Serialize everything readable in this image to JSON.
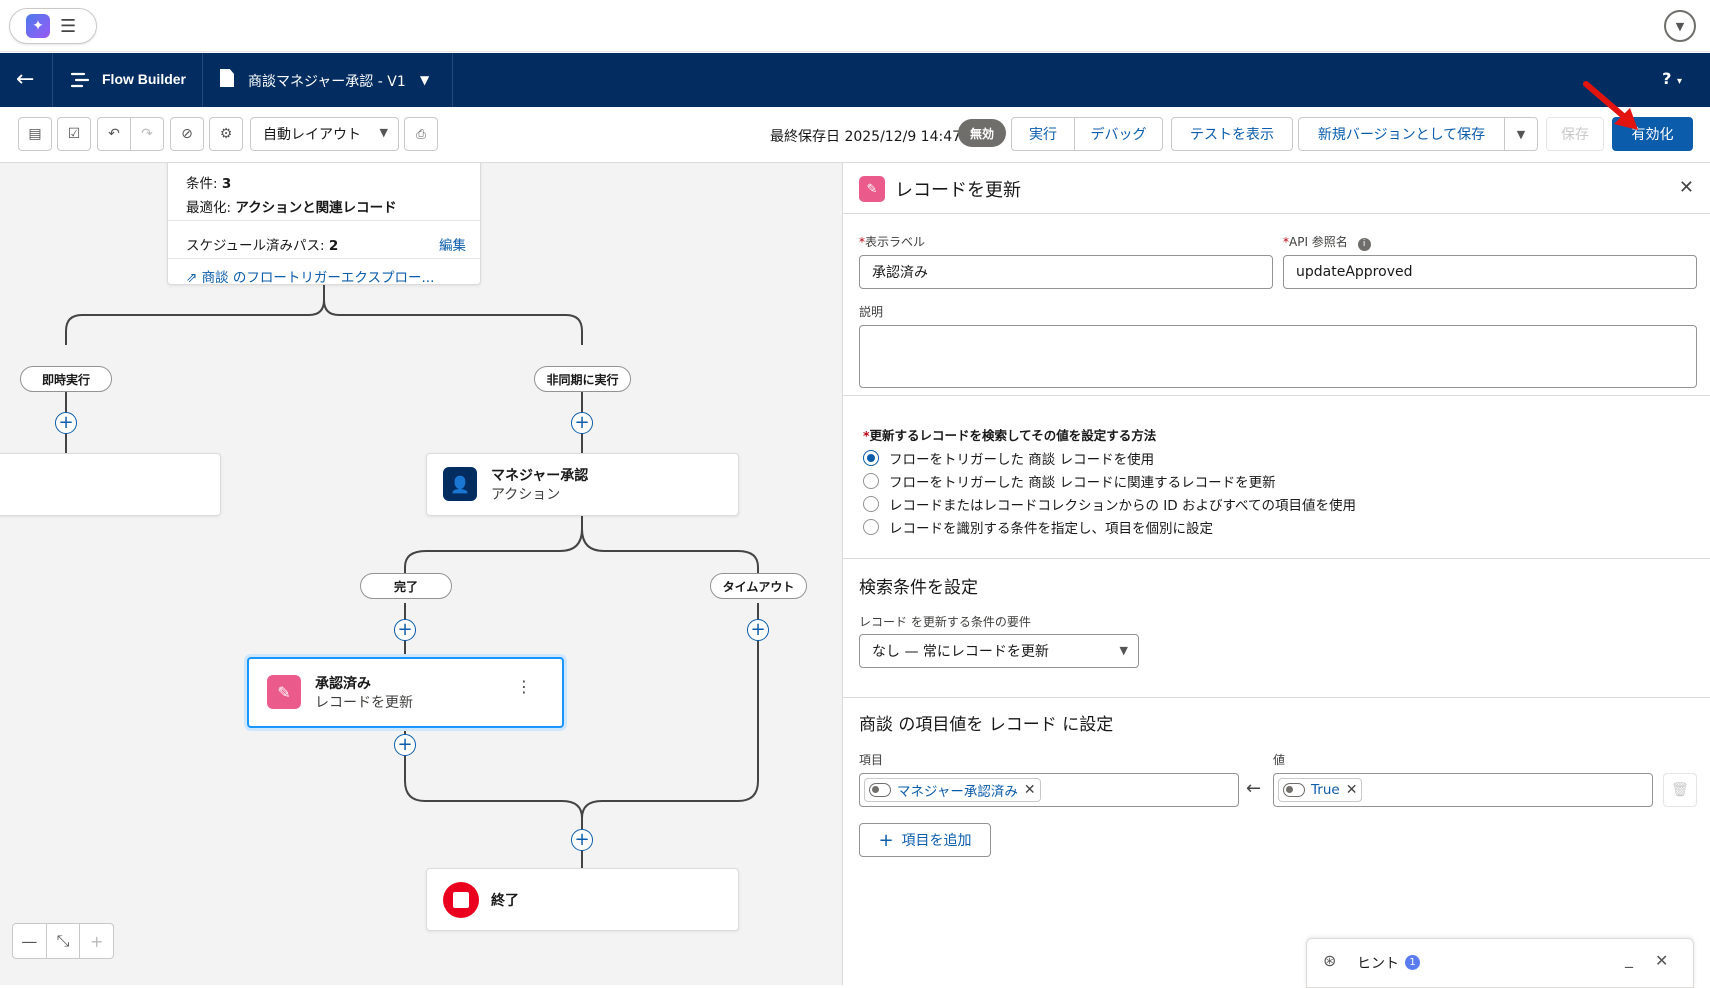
{
  "app": {
    "name": "Flow Builder",
    "flow_title": "商談マネジャー承認 - V1",
    "help_label": "?"
  },
  "toolbar": {
    "layout_mode": "自動レイアウト",
    "last_saved": "最終保存日 2025/12/9 14:47",
    "status_badge": "無効",
    "run": "実行",
    "debug": "デバッグ",
    "view_tests": "テストを表示",
    "save_as_new_version": "新規バージョンとして保存",
    "save": "保存",
    "activate": "有効化"
  },
  "canvas": {
    "start_card": {
      "conditions_label": "条件: ",
      "conditions_value": "3",
      "optimize_label": "最適化: ",
      "optimize_value": "アクションと関連レコード",
      "scheduled_label": "スケジュール済みパス: ",
      "scheduled_value": "2",
      "edit": "編集",
      "explorer_link": "商談 のフロートリガーエクスプロー..."
    },
    "paths": {
      "immediate": "即時実行",
      "async": "非同期に実行",
      "complete": "完了",
      "timeout": "タイムアウト"
    },
    "action_node": {
      "title": "マネジャー承認",
      "subtitle": "アクション"
    },
    "update_node": {
      "title": "承認済み",
      "subtitle": "レコードを更新"
    },
    "end_node": {
      "title": "終了"
    },
    "zoom": {
      "out": "—",
      "fit": "⤡",
      "in": "+"
    }
  },
  "panel": {
    "title": "レコードを更新",
    "label_field": {
      "label": "表示ラベル",
      "value": "承認済み"
    },
    "api_field": {
      "label": "API 参照名",
      "value": "updateApproved"
    },
    "description": {
      "label": "説明",
      "value": ""
    },
    "method": {
      "label": "更新するレコードを検索してその値を設定する方法",
      "options": [
        "フローをトリガーした 商談 レコードを使用",
        "フローをトリガーした 商談 レコードに関連するレコードを更新",
        "レコードまたはレコードコレクションからの ID およびすべての項目値を使用",
        "レコードを識別する条件を指定し、項目を個別に設定"
      ],
      "selected": 0
    },
    "filter": {
      "heading": "検索条件を設定",
      "label": "レコード を更新する条件の要件",
      "value": "なし — 常にレコードを更新"
    },
    "set_values": {
      "heading": "商談 の項目値を レコード に設定",
      "field_label": "項目",
      "value_label": "値",
      "field_chip": "マネジャー承認済み",
      "value_chip": "True",
      "add_button": "項目を追加"
    }
  },
  "hint": {
    "label": "ヒント",
    "count": "1"
  }
}
